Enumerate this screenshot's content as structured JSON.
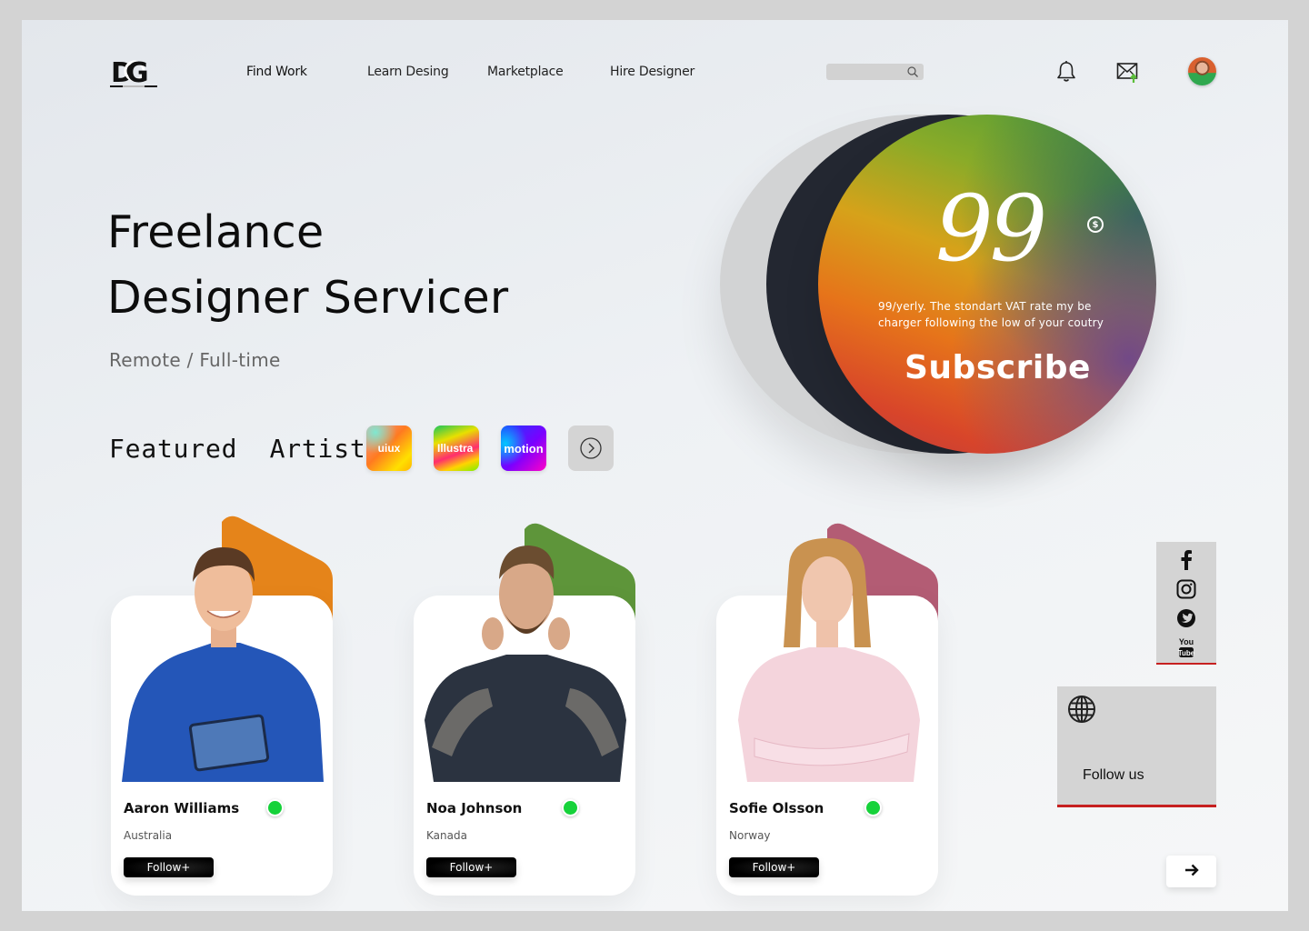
{
  "header": {
    "logo_text": "DG",
    "nav": [
      {
        "label": "Find Work",
        "active": true
      },
      {
        "label": "Learn Desing",
        "active": false
      },
      {
        "label": "Marketplace",
        "active": false
      },
      {
        "label": "Hire Designer",
        "active": false
      }
    ],
    "search_placeholder": "",
    "icons": [
      "search-icon",
      "bell-icon",
      "mail-upload-icon",
      "user-avatar"
    ]
  },
  "hero": {
    "title_line1": "Freelance",
    "title_line2": "Designer Servicer",
    "subtitle": "Remote / Full-time",
    "featured_label": "Featured  Artist",
    "featured_arrow": "↓",
    "categories": [
      {
        "label": "uiux"
      },
      {
        "label": "Illustra"
      },
      {
        "label": "motion"
      }
    ],
    "next_icon": "chevron-right-circle-icon"
  },
  "pricing": {
    "price": "99",
    "currency_icon": "$",
    "description_line1": "99/yerly. The stondart VAT rate my be",
    "description_line2": "charger following the low of your coutry",
    "cta": "Subscribe"
  },
  "artists": [
    {
      "name": "Aaron Williams",
      "country": "Australia",
      "online": true,
      "accent": "#e5841a",
      "follow_label": "Follow+"
    },
    {
      "name": "Noa Johnson",
      "country": "Kanada",
      "online": true,
      "accent": "#5e953a",
      "follow_label": "Follow+"
    },
    {
      "name": "Sofie Olsson",
      "country": "Norway",
      "online": true,
      "accent": "#b35c74",
      "follow_label": "Follow+"
    }
  ],
  "social": {
    "items": [
      "facebook",
      "instagram",
      "twitter",
      "youtube"
    ],
    "youtube_top": "You",
    "youtube_bottom": "Tube",
    "follow_label": "Follow us"
  },
  "colors": {
    "accent_red": "#c62020",
    "online_green": "#16d23a",
    "dark_circle": "#232731"
  }
}
